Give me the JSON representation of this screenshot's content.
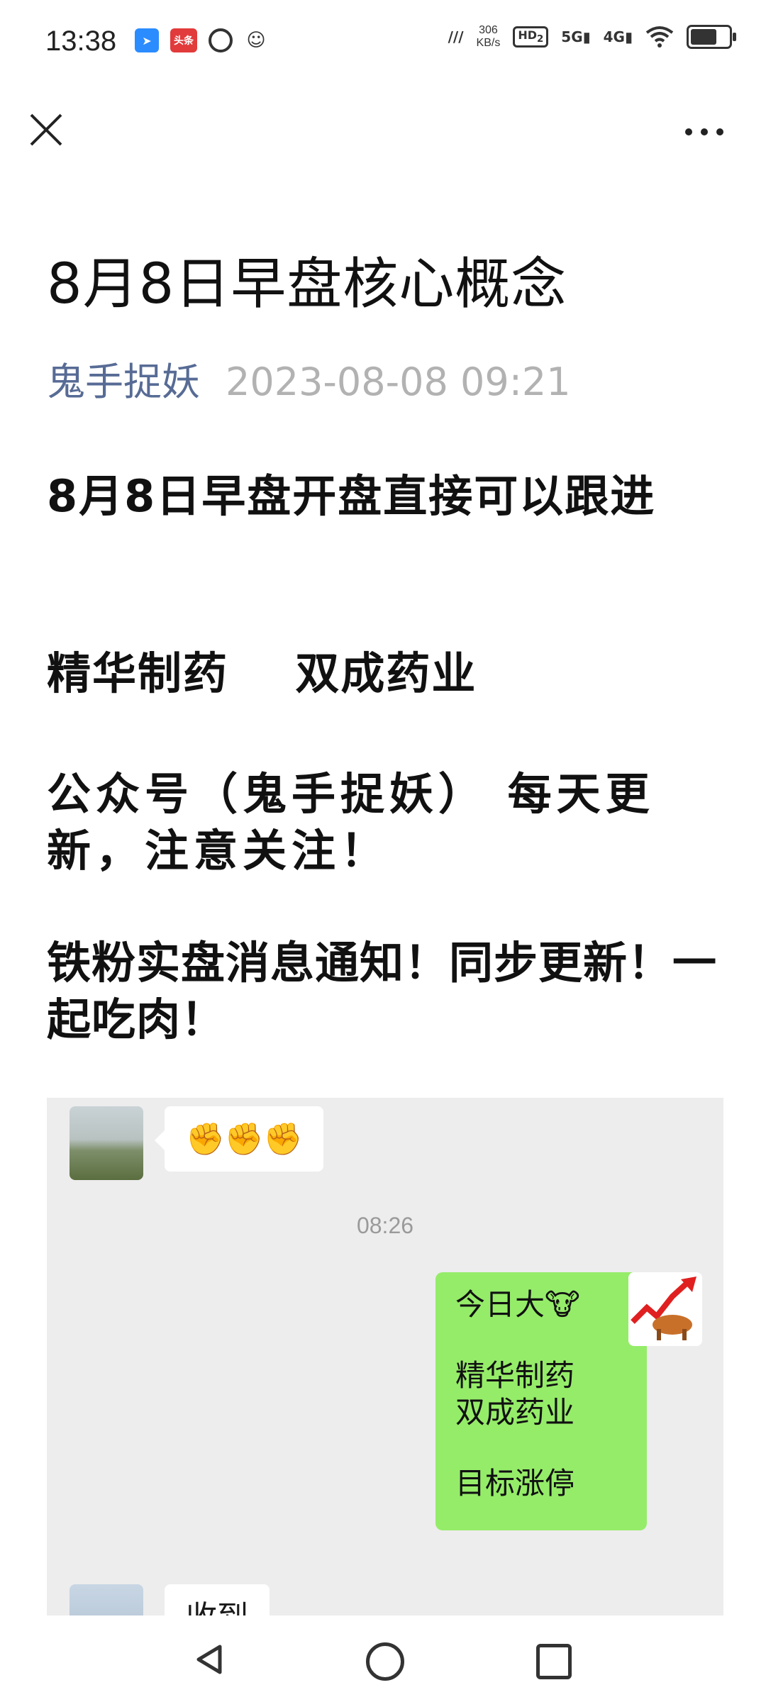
{
  "status_bar": {
    "time": "13:38",
    "app_badge": "头条",
    "net_speed_value": "306",
    "net_speed_unit": "KB/s",
    "hd_label": "HD",
    "hd_sub": "2",
    "sig_5g": "5G",
    "sig_4g": "4G",
    "icons": [
      "send-icon",
      "toutiao-icon",
      "ring-icon",
      "face-icon",
      "signal-icon",
      "wifi-icon",
      "battery-icon"
    ]
  },
  "nav": {
    "close_icon": "close-icon",
    "more_icon": "more-icon"
  },
  "article": {
    "title": "8月8日早盘核心概念",
    "author": "鬼手捉妖",
    "date": "2023-08-08 09:21",
    "paragraphs": [
      "8月8日早盘开盘直接可以跟进",
      "精华制药    双成药业",
      "公众号（鬼手捉妖） 每天更新，注意关注！",
      "铁粉实盘消息通知！同步更新！一起吃肉！"
    ]
  },
  "chat": {
    "first_message": "✊✊✊",
    "time": "08:26",
    "green_message": {
      "line1": "今日大🐮",
      "line2": "精华制药",
      "line3": "双成药业",
      "line4": "目标涨停"
    },
    "last_message": "收到"
  },
  "system_nav": {
    "icons": [
      "back-icon",
      "home-icon",
      "recents-icon"
    ]
  },
  "colors": {
    "author": "#576b95",
    "date": "#b2b2b2",
    "green_bubble": "#95ec69",
    "chat_bg": "#ededed"
  }
}
